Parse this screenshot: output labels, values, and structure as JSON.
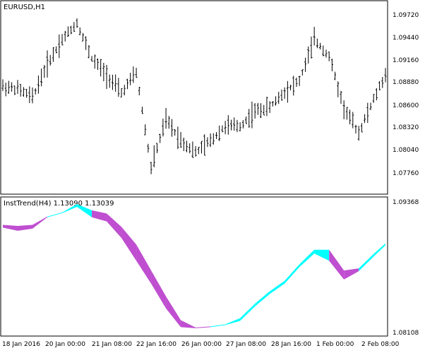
{
  "main_panel": {
    "title": "EURUSD,H1",
    "price_labels": [
      "1.09720",
      "1.09440",
      "1.09160",
      "1.08880",
      "1.08600",
      "1.08320",
      "1.08040",
      "1.07760"
    ]
  },
  "indicator_panel": {
    "title": "InstTrend(H4) 1.13090 1.13039",
    "scale_labels": [
      "1.09368",
      "1.08108"
    ]
  },
  "time_labels": [
    "18 Jan 2016",
    "20 Jan 00:00",
    "21 Jan 08:00",
    "22 Jan 16:00",
    "26 Jan 00:00",
    "27 Jan 08:00",
    "28 Jan 16:00",
    "1 Feb 00:00",
    "2 Feb 08:00"
  ],
  "colors": {
    "background": "#ffffff",
    "frame": "#000000",
    "bars": "#000000",
    "trend_up": "#00ffff",
    "trend_down": "#bf4fd0"
  },
  "chart_data": [
    {
      "type": "line",
      "title": "EURUSD,H1",
      "ylim": [
        1.0762,
        1.0986
      ],
      "x": [
        0,
        5,
        10,
        15,
        20,
        25,
        30,
        35,
        40,
        45,
        50,
        55,
        60,
        65,
        70,
        75,
        80,
        85,
        90,
        95,
        100,
        105,
        110,
        115,
        120,
        125,
        129
      ],
      "y": [
        1.0888,
        1.0885,
        1.0875,
        1.0915,
        1.0945,
        1.0965,
        1.0922,
        1.0902,
        1.088,
        1.0905,
        1.079,
        1.0848,
        1.0823,
        1.0808,
        1.0822,
        1.084,
        1.084,
        1.0858,
        1.0863,
        1.0882,
        1.0895,
        1.0945,
        1.0925,
        1.0862,
        1.0832,
        1.0872,
        1.0902
      ]
    },
    {
      "type": "area",
      "title": "InstTrend(H4) 1.13090 1.13039",
      "ylim": [
        1.08108,
        1.09368
      ],
      "x": [
        0,
        5,
        10,
        15,
        20,
        25,
        30,
        35,
        40,
        45,
        50,
        55,
        60,
        65,
        70,
        75,
        80,
        85,
        90,
        95,
        100,
        105,
        110,
        115,
        120,
        125,
        129
      ],
      "series": [
        {
          "values": [
            1.0914,
            1.0913,
            1.0914,
            1.0922,
            1.0926,
            1.0934,
            1.0928,
            1.0925,
            1.0912,
            1.0895,
            1.087,
            1.0845,
            1.0822,
            1.0815,
            1.0816,
            1.0818,
            1.0824,
            1.0838,
            1.085,
            1.086,
            1.0876,
            1.089,
            1.089,
            1.087,
            1.0872,
            1.0886,
            1.0896
          ]
        },
        {
          "values": [
            1.0912,
            1.0909,
            1.0911,
            1.0922,
            1.0926,
            1.0932,
            1.0922,
            1.0918,
            1.0902,
            1.088,
            1.0858,
            1.0834,
            1.0816,
            1.0815,
            1.0816,
            1.0818,
            1.0822,
            1.0836,
            1.0848,
            1.0858,
            1.0874,
            1.0887,
            1.088,
            1.0862,
            1.087,
            1.0884,
            1.0895
          ]
        }
      ],
      "trend": [
        "down",
        "down",
        "down",
        "up",
        "up",
        "up",
        "down",
        "down",
        "down",
        "down",
        "down",
        "down",
        "down",
        "down",
        "up",
        "up",
        "up",
        "up",
        "up",
        "up",
        "up",
        "up",
        "down",
        "down",
        "up",
        "up",
        "up"
      ]
    }
  ]
}
